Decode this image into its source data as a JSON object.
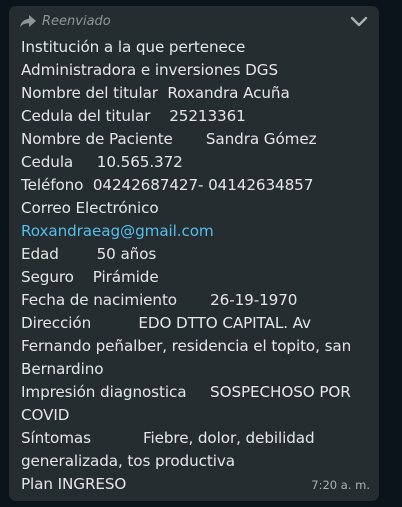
{
  "message": {
    "forwarded_label": "Reenviado",
    "lines": [
      "Institución a la que pertenece",
      "Administradora e inversiones DGS",
      "Nombre del titular  Roxandra Acuña",
      "Cedula del titular    25213361",
      "Nombre de Paciente       Sandra Gómez",
      "Cedula     10.565.372",
      "Teléfono  04242687427- 04142634857",
      "Correo Electrónico"
    ],
    "email": "Roxandraeag@gmail.com",
    "lines_after_email": [
      "Edad        50 años",
      "Seguro    Pirámide",
      "Fecha de nacimiento       26-19-1970"
    ],
    "direccion": "Dirección          EDO DTTO CAPITAL. Av Fernando peñalber, residencia el topito, san Bernardino",
    "impresion": "Impresión diagnostica     SOSPECHOSO POR COVID",
    "sintomas": "Síntomas           Fiebre, dolor, debilidad generalizada, tos productiva",
    "plan": "Plan INGRESO",
    "time": "7:20 a. m."
  },
  "colors": {
    "background": "#0b141a",
    "bubble": "#262d31",
    "text": "#e6e6e6",
    "link": "#53bdeb",
    "meta": "#8f979c"
  },
  "icons": [
    "forward-arrow-icon",
    "chevron-down-icon"
  ]
}
